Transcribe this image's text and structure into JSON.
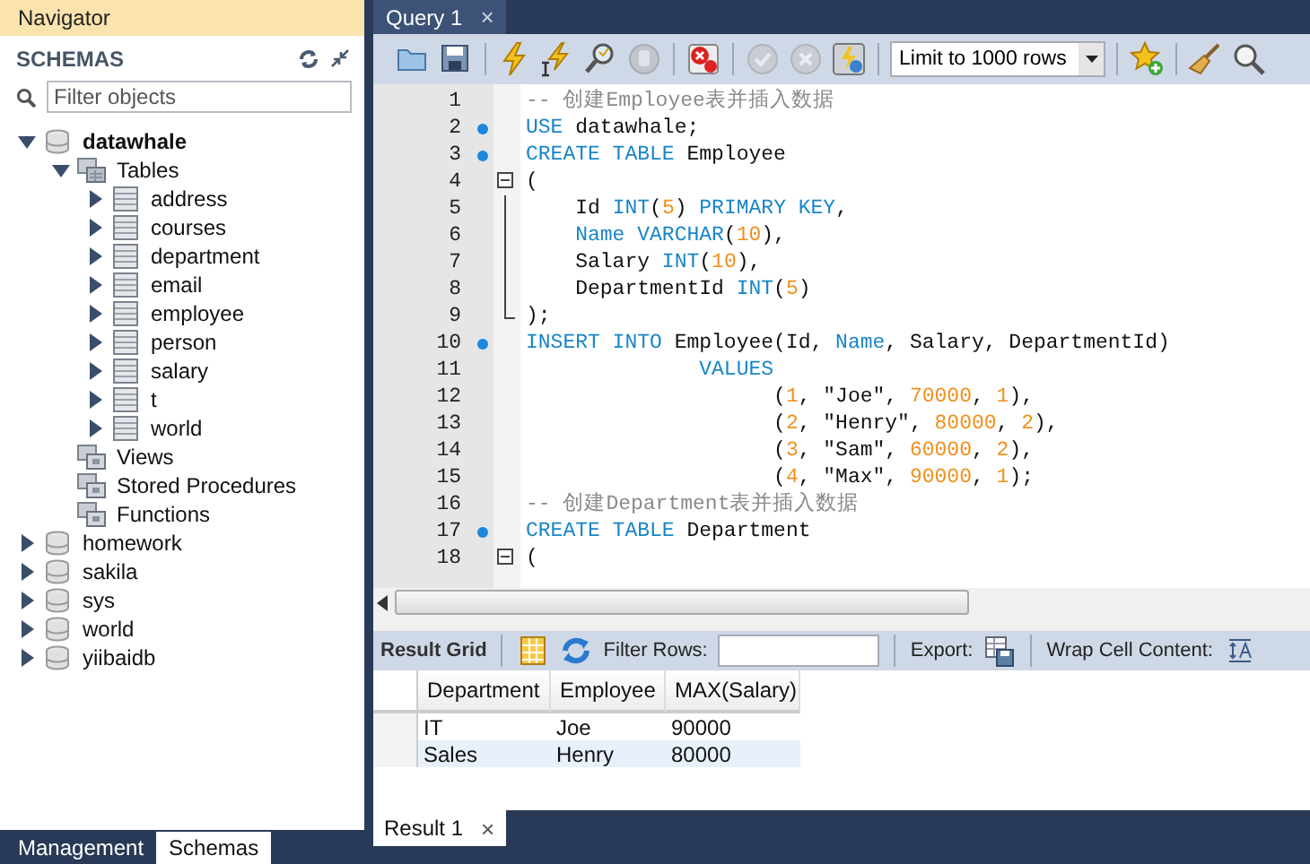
{
  "navigator": {
    "title": "Navigator",
    "section": "SCHEMAS",
    "filter": {
      "placeholder": "Filter objects"
    },
    "schemas": [
      {
        "name": "datawhale",
        "default": true,
        "expanded": true,
        "children": [
          {
            "name": "Tables",
            "kind": "folder",
            "expanded": true,
            "children": [
              {
                "name": "address",
                "kind": "table",
                "expanded": false
              },
              {
                "name": "courses",
                "kind": "table",
                "expanded": false
              },
              {
                "name": "department",
                "kind": "table",
                "expanded": false
              },
              {
                "name": "email",
                "kind": "table",
                "expanded": false
              },
              {
                "name": "employee",
                "kind": "table",
                "expanded": false
              },
              {
                "name": "person",
                "kind": "table",
                "expanded": false
              },
              {
                "name": "salary",
                "kind": "table",
                "expanded": false
              },
              {
                "name": "t",
                "kind": "table",
                "expanded": false
              },
              {
                "name": "world",
                "kind": "table",
                "expanded": false
              }
            ]
          },
          {
            "name": "Views",
            "kind": "group"
          },
          {
            "name": "Stored Procedures",
            "kind": "group"
          },
          {
            "name": "Functions",
            "kind": "group"
          }
        ]
      },
      {
        "name": "homework",
        "default": false,
        "expanded": false
      },
      {
        "name": "sakila",
        "default": false,
        "expanded": false
      },
      {
        "name": "sys",
        "default": false,
        "expanded": false
      },
      {
        "name": "world",
        "default": false,
        "expanded": false
      },
      {
        "name": "yiibaidb",
        "default": false,
        "expanded": false
      }
    ],
    "bottom_tabs": [
      {
        "label": "Management",
        "selected": false
      },
      {
        "label": "Schemas",
        "selected": true
      }
    ]
  },
  "editor_tabs": [
    {
      "label": "Query 1",
      "close": "×",
      "selected": true
    }
  ],
  "toolbar": [
    {
      "kind": "open",
      "disabled": false
    },
    {
      "kind": "save",
      "disabled": false
    },
    {
      "kind": "separator"
    },
    {
      "kind": "execute",
      "disabled": false
    },
    {
      "kind": "execute_current",
      "disabled": false
    },
    {
      "kind": "explain",
      "disabled": false
    },
    {
      "kind": "stop",
      "disabled": true
    },
    {
      "kind": "separator"
    },
    {
      "kind": "error_toggle",
      "disabled": false
    },
    {
      "kind": "separator"
    },
    {
      "kind": "commit",
      "disabled": true
    },
    {
      "kind": "rollback",
      "disabled": true
    },
    {
      "kind": "autocommit",
      "disabled": false
    },
    {
      "kind": "separator"
    },
    {
      "kind": "limit",
      "value": "Limit to 1000 rows"
    },
    {
      "kind": "separator"
    },
    {
      "kind": "snippet",
      "disabled": false
    },
    {
      "kind": "separator"
    },
    {
      "kind": "beautify",
      "disabled": false
    },
    {
      "kind": "find",
      "disabled": false
    }
  ],
  "code": [
    {
      "number": "1",
      "marker": false,
      "kind": "plain",
      "tokens": [
        {
          "kind": "comment",
          "text": "-- 创建Employee表并插入数据"
        }
      ]
    },
    {
      "number": "2",
      "marker": true,
      "kind": "plain",
      "tokens": [
        {
          "kind": "keyword",
          "text": "USE"
        },
        {
          "kind": "plain",
          "text": " datawhale;"
        }
      ]
    },
    {
      "number": "3",
      "marker": true,
      "kind": "plain",
      "tokens": [
        {
          "kind": "keyword",
          "text": "CREATE TABLE"
        },
        {
          "kind": "plain",
          "text": " Employee"
        }
      ]
    },
    {
      "number": "4",
      "marker": false,
      "kind": "fold_start",
      "tokens": [
        {
          "kind": "plain",
          "text": "("
        }
      ]
    },
    {
      "number": "5",
      "marker": false,
      "kind": "fold_body",
      "tokens": [
        {
          "kind": "plain",
          "text": "    Id "
        },
        {
          "kind": "keyword",
          "text": "INT"
        },
        {
          "kind": "plain",
          "text": "("
        },
        {
          "kind": "number",
          "text": "5"
        },
        {
          "kind": "plain",
          "text": ") "
        },
        {
          "kind": "keyword",
          "text": "PRIMARY KEY"
        },
        {
          "kind": "plain",
          "text": ","
        }
      ]
    },
    {
      "number": "6",
      "marker": false,
      "kind": "fold_body",
      "tokens": [
        {
          "kind": "keyword",
          "text": "    Name VARCHAR"
        },
        {
          "kind": "plain",
          "text": "("
        },
        {
          "kind": "number",
          "text": "10"
        },
        {
          "kind": "plain",
          "text": "),"
        }
      ]
    },
    {
      "number": "7",
      "marker": false,
      "kind": "fold_body",
      "tokens": [
        {
          "kind": "plain",
          "text": "    Salary "
        },
        {
          "kind": "keyword",
          "text": "INT"
        },
        {
          "kind": "plain",
          "text": "("
        },
        {
          "kind": "number",
          "text": "10"
        },
        {
          "kind": "plain",
          "text": "),"
        }
      ]
    },
    {
      "number": "8",
      "marker": false,
      "kind": "fold_body",
      "tokens": [
        {
          "kind": "plain",
          "text": "    DepartmentId "
        },
        {
          "kind": "keyword",
          "text": "INT"
        },
        {
          "kind": "plain",
          "text": "("
        },
        {
          "kind": "number",
          "text": "5"
        },
        {
          "kind": "plain",
          "text": ")"
        }
      ]
    },
    {
      "number": "9",
      "marker": false,
      "kind": "fold_end",
      "tokens": [
        {
          "kind": "plain",
          "text": ");"
        }
      ]
    },
    {
      "number": "10",
      "marker": true,
      "kind": "plain",
      "tokens": [
        {
          "kind": "keyword",
          "text": "INSERT INTO"
        },
        {
          "kind": "plain",
          "text": " Employee(Id, "
        },
        {
          "kind": "keyword",
          "text": "Name"
        },
        {
          "kind": "plain",
          "text": ", Salary, DepartmentId)"
        }
      ]
    },
    {
      "number": "11",
      "marker": false,
      "kind": "plain",
      "tokens": [
        {
          "kind": "keyword",
          "text": "              VALUES"
        }
      ]
    },
    {
      "number": "12",
      "marker": false,
      "kind": "plain",
      "tokens": [
        {
          "kind": "plain",
          "text": "                    ("
        },
        {
          "kind": "number",
          "text": "1"
        },
        {
          "kind": "plain",
          "text": ", \"Joe\", "
        },
        {
          "kind": "number",
          "text": "70000"
        },
        {
          "kind": "plain",
          "text": ", "
        },
        {
          "kind": "number",
          "text": "1"
        },
        {
          "kind": "plain",
          "text": "),"
        }
      ]
    },
    {
      "number": "13",
      "marker": false,
      "kind": "plain",
      "tokens": [
        {
          "kind": "plain",
          "text": "                    ("
        },
        {
          "kind": "number",
          "text": "2"
        },
        {
          "kind": "plain",
          "text": ", \"Henry\", "
        },
        {
          "kind": "number",
          "text": "80000"
        },
        {
          "kind": "plain",
          "text": ", "
        },
        {
          "kind": "number",
          "text": "2"
        },
        {
          "kind": "plain",
          "text": "),"
        }
      ]
    },
    {
      "number": "14",
      "marker": false,
      "kind": "plain",
      "tokens": [
        {
          "kind": "plain",
          "text": "                    ("
        },
        {
          "kind": "number",
          "text": "3"
        },
        {
          "kind": "plain",
          "text": ", \"Sam\", "
        },
        {
          "kind": "number",
          "text": "60000"
        },
        {
          "kind": "plain",
          "text": ", "
        },
        {
          "kind": "number",
          "text": "2"
        },
        {
          "kind": "plain",
          "text": "),"
        }
      ]
    },
    {
      "number": "15",
      "marker": false,
      "kind": "plain",
      "tokens": [
        {
          "kind": "plain",
          "text": "                    ("
        },
        {
          "kind": "number",
          "text": "4"
        },
        {
          "kind": "plain",
          "text": ", \"Max\", "
        },
        {
          "kind": "number",
          "text": "90000"
        },
        {
          "kind": "plain",
          "text": ", "
        },
        {
          "kind": "number",
          "text": "1"
        },
        {
          "kind": "plain",
          "text": ");"
        }
      ]
    },
    {
      "number": "16",
      "marker": false,
      "kind": "plain",
      "tokens": [
        {
          "kind": "comment",
          "text": "-- 创建Department表并插入数据"
        }
      ]
    },
    {
      "number": "17",
      "marker": true,
      "kind": "plain",
      "tokens": [
        {
          "kind": "keyword",
          "text": "CREATE TABLE"
        },
        {
          "kind": "plain",
          "text": " Department"
        }
      ]
    },
    {
      "number": "18",
      "marker": false,
      "kind": "fold_start",
      "tokens": [
        {
          "kind": "plain",
          "text": "("
        }
      ]
    }
  ],
  "result_toolbar": {
    "title": "Result Grid",
    "filter_label": "Filter Rows:",
    "export_label": "Export:",
    "wrap_label": "Wrap Cell Content:"
  },
  "grid": {
    "columns": [
      "Department",
      "Employee",
      "MAX(Salary)"
    ],
    "rows": [
      [
        "IT",
        "Joe",
        "90000"
      ],
      [
        "Sales",
        "Henry",
        "80000"
      ]
    ]
  },
  "result_tabs": [
    {
      "label": "Result 1",
      "close": "×",
      "selected": true
    }
  ]
}
